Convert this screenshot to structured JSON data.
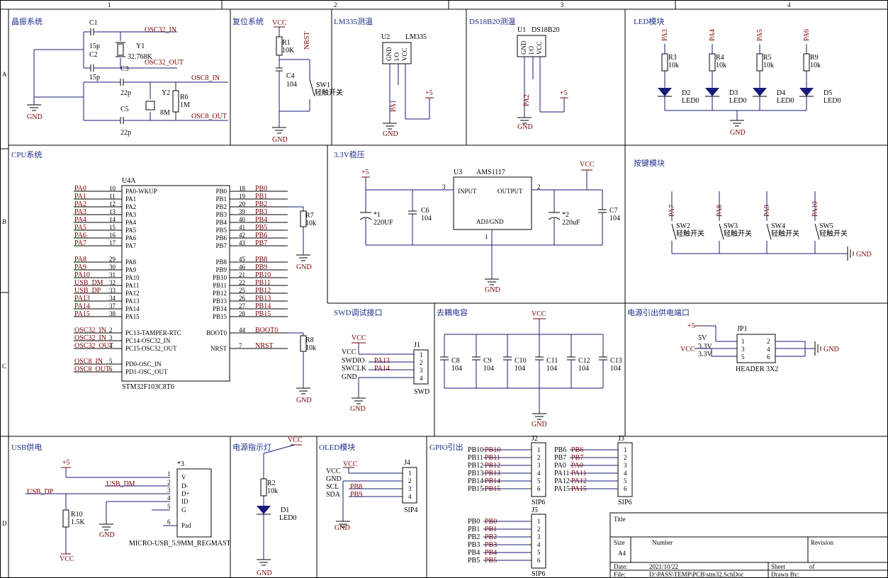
{
  "border": {
    "cols": [
      "1",
      "2",
      "3",
      "4"
    ],
    "rows": [
      "A",
      "B",
      "C",
      "D"
    ]
  },
  "sections": {
    "osc": "晶振系统",
    "reset": "复位系统",
    "lm335": "LM335测温",
    "ds18b20": "DS18B20测温",
    "led": "LED模块",
    "cpu": "CPU系统",
    "reg": "3.3V稳压",
    "keys": "按键模块",
    "swd": "SWD调试接口",
    "decap": "去耦电容",
    "power": "电源引出供电端口",
    "usb": "USB供电",
    "pwrled": "电源指示灯",
    "oled": "OLED模块",
    "gpio": "GPIO引出"
  },
  "osc": {
    "c1": "C1",
    "c1v": "15p",
    "c2": "C2",
    "c2v": "15p",
    "y1": "Y1",
    "y1v": "32.768K",
    "osc32in": "OSC32_IN",
    "osc32out": "OSC32_OUT",
    "c3": "C3",
    "c3v": "22p",
    "c5": "C5",
    "c5v": "22p",
    "y2": "Y2",
    "y2v": "8M",
    "r6": "R6",
    "r6v": "1M",
    "osc8in": "OSC8_IN",
    "osc8out": "OSC8_OUT",
    "gnd": "GND"
  },
  "reset": {
    "vcc": "VCC",
    "r1": "R1",
    "r1v": "10K",
    "nrst": "NRST",
    "c4": "C4",
    "c4v": "104",
    "sw1": "SW1",
    "sw1v": "轻触开关",
    "gnd": "GND"
  },
  "lm335": {
    "u2": "U2",
    "name": "LM335",
    "pins": [
      "GND",
      "I/O",
      "VCC"
    ],
    "pa1": "PA1",
    "p5": "+5",
    "gnd": "GND"
  },
  "ds18b20": {
    "u1": "U1",
    "name": "DS18B20",
    "pins": [
      "GND",
      "I/O",
      "VCC"
    ],
    "pa2": "PA2",
    "p5": "+5",
    "gnd": "GND"
  },
  "led": {
    "items": [
      {
        "net": "PA3",
        "r": "R3",
        "rv": "10k",
        "d": "D2",
        "dv": "LED0"
      },
      {
        "net": "PA4",
        "r": "R4",
        "rv": "10k",
        "d": "D3",
        "dv": "LED0"
      },
      {
        "net": "PA5",
        "r": "R5",
        "rv": "10k",
        "d": "D4",
        "dv": "LED0"
      },
      {
        "net": "PA6",
        "r": "R9",
        "rv": "10k",
        "d": "D5",
        "dv": "LED0"
      }
    ],
    "gnd": "GND"
  },
  "cpu": {
    "ref": "U4A",
    "part": "STM32F103C8T6",
    "left": [
      {
        "net": "PA0",
        "num": "10",
        "name": "PA0-WKUP"
      },
      {
        "net": "PA1",
        "num": "11",
        "name": "PA1"
      },
      {
        "net": "PA2",
        "num": "12",
        "name": "PA2"
      },
      {
        "net": "PA3",
        "num": "13",
        "name": "PA3"
      },
      {
        "net": "PA4",
        "num": "14",
        "name": "PA4"
      },
      {
        "net": "PA5",
        "num": "15",
        "name": "PA5"
      },
      {
        "net": "PA6",
        "num": "16",
        "name": "PA6"
      },
      {
        "net": "PA7",
        "num": "17",
        "name": "PA7"
      },
      {
        "net": "PA8",
        "num": "29",
        "name": "PA8"
      },
      {
        "net": "PA9",
        "num": "30",
        "name": "PA9"
      },
      {
        "net": "PA10",
        "num": "31",
        "name": "PA10"
      },
      {
        "net": "USB_DM",
        "num": "32",
        "name": "PA11"
      },
      {
        "net": "USB_DP",
        "num": "33",
        "name": "PA12"
      },
      {
        "net": "PA13",
        "num": "34",
        "name": "PA13"
      },
      {
        "net": "PA14",
        "num": "37",
        "name": "PA14"
      },
      {
        "net": "PA15",
        "num": "38",
        "name": "PA15"
      },
      {
        "net": "OSC32_IN",
        "num": "2",
        "name": "PC13-TAMPER-RTC"
      },
      {
        "net": "OSC32_IN",
        "num": "3",
        "name": "PC14-OSC32_IN"
      },
      {
        "net": "OSC32_OUT",
        "num": "4",
        "name": "PC15-OSC32_OUT"
      },
      {
        "net": "OSC8_IN",
        "num": "5",
        "name": "PD0-OSC_IN"
      },
      {
        "net": "OSC8_OUT",
        "num": "6",
        "name": "PD1-OSC_OUT"
      }
    ],
    "right": [
      {
        "net": "PB0",
        "num": "18",
        "name": "PB0"
      },
      {
        "net": "PB1",
        "num": "19",
        "name": "PB1"
      },
      {
        "net": "PB2",
        "num": "20",
        "name": "PB2"
      },
      {
        "net": "PB3",
        "num": "39",
        "name": "PB3"
      },
      {
        "net": "PB4",
        "num": "40",
        "name": "PB4"
      },
      {
        "net": "PB5",
        "num": "41",
        "name": "PB5"
      },
      {
        "net": "PB6",
        "num": "42",
        "name": "PB6"
      },
      {
        "net": "PB7",
        "num": "43",
        "name": "PB7"
      },
      {
        "net": "PB8",
        "num": "45",
        "name": "PB8"
      },
      {
        "net": "PB9",
        "num": "46",
        "name": "PB9"
      },
      {
        "net": "PB10",
        "num": "21",
        "name": "PB10"
      },
      {
        "net": "PB11",
        "num": "22",
        "name": "PB11"
      },
      {
        "net": "PB12",
        "num": "25",
        "name": "PB12"
      },
      {
        "net": "PB13",
        "num": "26",
        "name": "PB13"
      },
      {
        "net": "PB14",
        "num": "27",
        "name": "PB14"
      },
      {
        "net": "PB15",
        "num": "28",
        "name": "PB15"
      },
      {
        "net": "BOOT0",
        "num": "44",
        "name": "BOOT0"
      },
      {
        "net": "NRST",
        "num": "7",
        "name": "NRST"
      }
    ],
    "r7": "R7",
    "r7v": "10k",
    "r8": "R8",
    "r8v": "10k",
    "gnd": "GND"
  },
  "reg": {
    "u3": "U3",
    "name": "AMS1117",
    "input": "INPUT",
    "output": "OUTPUT",
    "adj": "ADJ/GND",
    "p5": "+5",
    "vcc": "VCC",
    "c1": "*1",
    "c1v": "220UF",
    "c6": "C6",
    "c6v": "104",
    "c2": "*2",
    "c2v": "220uF",
    "c7": "C7",
    "c7v": "104",
    "p3": "3",
    "p2": "2",
    "p1": "1",
    "gnd": "GND"
  },
  "keys": {
    "items": [
      {
        "net": "PA7",
        "sw": "SW2",
        "label": "轻触开关"
      },
      {
        "net": "PA8",
        "sw": "SW3",
        "label": "轻触开关"
      },
      {
        "net": "PA9",
        "sw": "SW4",
        "label": "轻触开关"
      },
      {
        "net": "PA10",
        "sw": "SW5",
        "label": "轻触开关"
      }
    ],
    "gnd": "GND"
  },
  "swd": {
    "vcc": "VCC",
    "vcc2": "VCC",
    "swdio": "SWDIO",
    "swclk": "SWCLK",
    "gnd": "GND",
    "pa13": "PA13",
    "pa14": "PA14",
    "j1": "J1",
    "name": "SWD",
    "pins": [
      "1",
      "2",
      "3",
      "4"
    ],
    "gnd2": "GND"
  },
  "decap": {
    "vcc": "VCC",
    "caps": [
      {
        "ref": "C8",
        "v": "104"
      },
      {
        "ref": "C9",
        "v": "104"
      },
      {
        "ref": "C10",
        "v": "104"
      },
      {
        "ref": "C11",
        "v": "104"
      },
      {
        "ref": "C12",
        "v": "104"
      },
      {
        "ref": "C13",
        "v": "104"
      }
    ],
    "gnd": "GND"
  },
  "power": {
    "p5": "+5",
    "v5": "5V",
    "vcc": "VCC",
    "v33a": "3.3V",
    "v33b": "3.3V",
    "jp1": "JP1",
    "name": "HEADER 3X2",
    "lp": [
      "1",
      "3",
      "5"
    ],
    "rp": [
      "2",
      "4",
      "6"
    ],
    "gnd": "GND"
  },
  "usb": {
    "p5": "+5",
    "usbdm": "USB_DM",
    "usbdp": "USB_DP",
    "r10": "R10",
    "r10v": "1.5K",
    "vcc": "VCC",
    "gnd": "GND",
    "ref": "*3",
    "pins": [
      {
        "n": "1",
        "l": "V"
      },
      {
        "n": "2",
        "l": "D-"
      },
      {
        "n": "3",
        "l": "D+"
      },
      {
        "n": "4",
        "l": "ID"
      },
      {
        "n": "5",
        "l": "G"
      },
      {
        "n": "6",
        "l": "Pad"
      }
    ],
    "part": "MICRO-USB_5.9MM_REGMAST"
  },
  "pwrled": {
    "vcc": "VCC",
    "r2": "R2",
    "r2v": "10k",
    "d1": "D1",
    "d1v": "LED0",
    "gnd": "GND"
  },
  "oled": {
    "labels": [
      "VCC",
      "GND",
      "SCL",
      "SDA"
    ],
    "vcc": "VCC",
    "pb8": "PB8",
    "pb9": "PB9",
    "j4": "J4",
    "name": "SIP4",
    "pins": [
      "1",
      "2",
      "3",
      "4"
    ],
    "gnd": "GND"
  },
  "gpio": {
    "j2": {
      "ref": "J2",
      "name": "SIP6",
      "labels": [
        "PB10",
        "PB11",
        "PB12",
        "PB13",
        "PB14",
        "PB15"
      ],
      "nets": [
        "PB10",
        "PB11",
        "PB12",
        "PB13",
        "PB14",
        "PB15"
      ]
    },
    "j3": {
      "ref": "J3",
      "name": "SIP6",
      "labels": [
        "PB6",
        "PB7",
        "PA0",
        "PA11",
        "PA12",
        "PA15"
      ],
      "nets": [
        "PB6",
        "PB7",
        "PA0",
        "PA11",
        "PA12",
        "PA15"
      ]
    },
    "j5": {
      "ref": "J5",
      "name": "SIP6",
      "labels": [
        "PB0",
        "PB1",
        "PB2",
        "PB3",
        "PB4",
        "PB5"
      ],
      "nets": [
        "PB0",
        "PB1",
        "PB2",
        "PB3",
        "PB4",
        "PB5"
      ]
    },
    "pins": [
      "1",
      "2",
      "3",
      "4",
      "5",
      "6"
    ]
  },
  "titleblock": {
    "title": "Title",
    "size": "Size",
    "sizev": "A4",
    "number": "Number",
    "revision": "Revision",
    "date": "Date:",
    "datev": "2021/10/22",
    "sheet": "Sheet",
    "of": "of",
    "file": "File:",
    "filev": "D:\\PASS\\TEMP\\PCB\\stm32.SchDoc",
    "drawn": "Drawn By:"
  }
}
